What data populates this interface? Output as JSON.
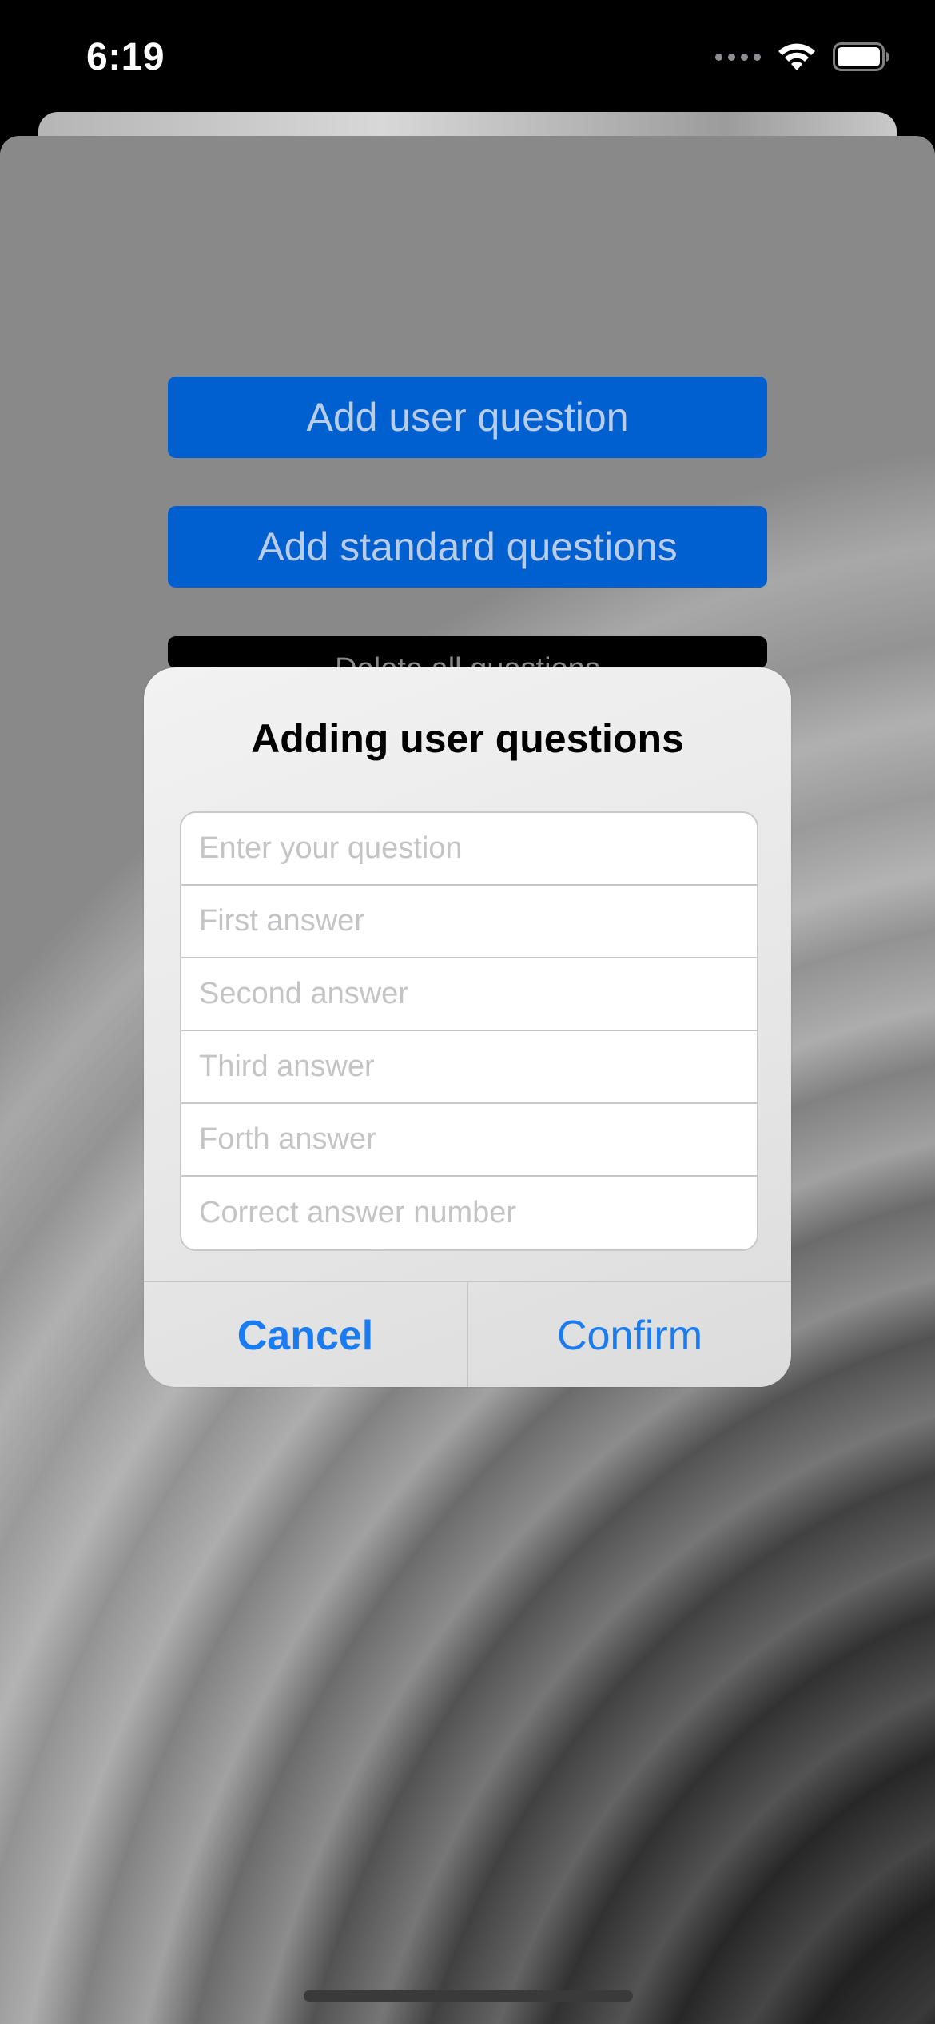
{
  "status_bar": {
    "time": "6:19",
    "icons": [
      "cellular-dots-icon",
      "wifi-icon",
      "battery-icon"
    ]
  },
  "background_buttons": {
    "add_user_question": "Add user question",
    "add_standard_questions": "Add standard questions",
    "delete_all_questions": "Delete all questions"
  },
  "alert": {
    "title": "Adding user questions",
    "fields": {
      "question_placeholder": "Enter your question",
      "first_answer_placeholder": "First answer",
      "second_answer_placeholder": "Second answer",
      "third_answer_placeholder": "Third answer",
      "fourth_answer_placeholder": "Forth answer",
      "correct_answer_placeholder": "Correct answer number"
    },
    "cancel_label": "Cancel",
    "confirm_label": "Confirm"
  },
  "colors": {
    "primary_button": "#0060d0",
    "alert_action": "#1a7cf0"
  }
}
